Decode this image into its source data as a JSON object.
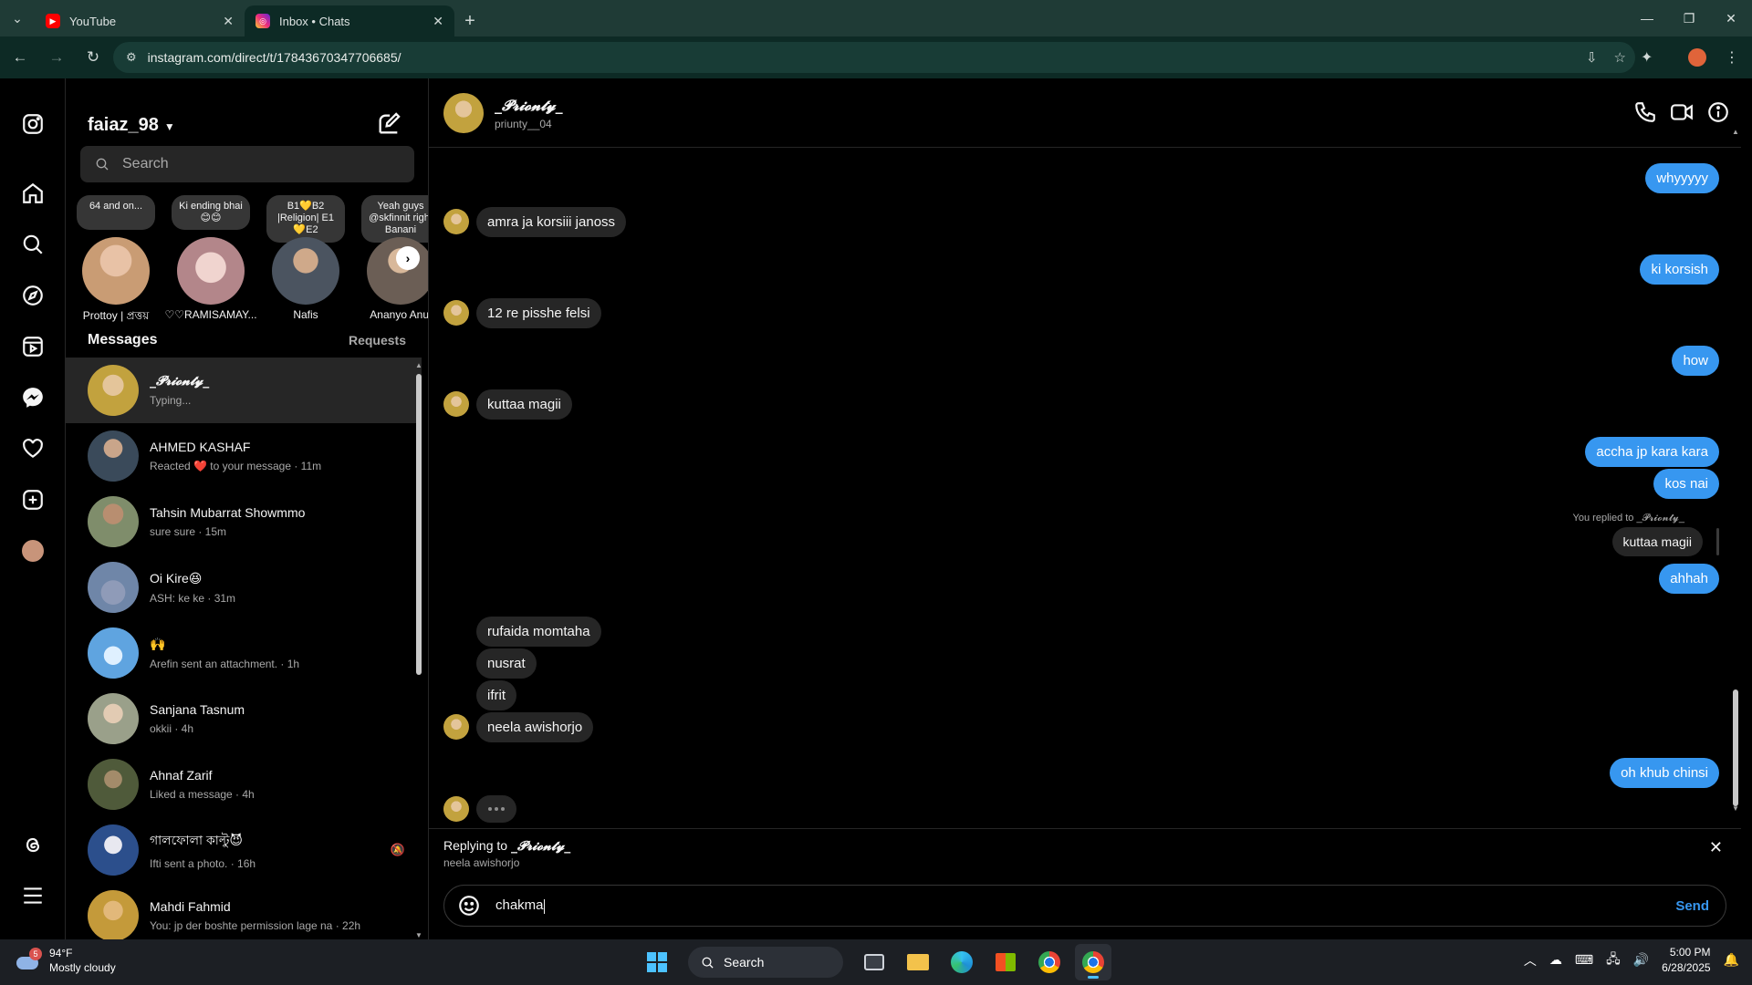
{
  "browser": {
    "tabs": [
      {
        "title": "YouTube",
        "active": false
      },
      {
        "title": "Inbox • Chats",
        "active": true
      }
    ],
    "url": "instagram.com/direct/t/17843670347706685/"
  },
  "sidebar": {
    "username": "faiaz_98",
    "search_placeholder": "Search",
    "notes": [
      {
        "text": "64 and on...",
        "name": "Prottoy | প্রত্তয়",
        "color": "#c99c74"
      },
      {
        "text": "Ki ending bhai 😊😊",
        "name": "♡♡RAMISAMAY...",
        "color": "#b3868a"
      },
      {
        "text": "B1💛B2 |Religion| E1💛E2",
        "name": "Nafis",
        "color": "#4b5460"
      },
      {
        "text": "Yeah guys @skfinnit right Banani",
        "name": "Ananyo Anul",
        "color": "#6b5e55"
      }
    ],
    "messages_label": "Messages",
    "requests_label": "Requests",
    "threads": [
      {
        "name": "_𝓟𝓻𝓲𝓸𝓷𝓽𝔂_",
        "preview": "Typing...",
        "selected": true,
        "color": "#c2a23e"
      },
      {
        "name": "AHMED KASHAF",
        "preview": "Reacted ❤️ to your message · 11m",
        "color": "#3a4a5a"
      },
      {
        "name": "Tahsin Mubarrat Showmmo",
        "preview": "sure sure · 15m",
        "color": "#7f8d6b"
      },
      {
        "name": "Oi Kire😆",
        "preview": "ASH: ke ke · 31m",
        "color": "#6f86a8"
      },
      {
        "name": "🙌",
        "preview": "Arefin sent an attachment. · 1h",
        "color": "#5fa4e0"
      },
      {
        "name": "Sanjana Tasnum",
        "preview": "okkii · 4h",
        "color": "#9aa08a"
      },
      {
        "name": "Ahnaf Zarif",
        "preview": "Liked a message · 4h",
        "color": "#4f5a3a"
      },
      {
        "name": "গালফোলা কাল্টু😈",
        "preview": "Ifti sent a photo. · 16h",
        "muted": true,
        "color": "#2c4f8c"
      },
      {
        "name": "Mahdi Fahmid",
        "preview": "You: jp der boshte permission lage na · 22h",
        "color": "#c49a3a"
      }
    ]
  },
  "chat": {
    "name": "_𝓟𝓻𝓲𝓸𝓷𝓽𝔂_",
    "username": "priunty__04",
    "messages": [
      {
        "dir": "out",
        "text": "whyyyyy"
      },
      {
        "dir": "in",
        "text": "amra ja korsiii janoss"
      },
      {
        "dir": "out",
        "text": "ki korsish"
      },
      {
        "dir": "in",
        "text": "12 re pisshe felsi"
      },
      {
        "dir": "out",
        "text": "how"
      },
      {
        "dir": "in",
        "text": "kuttaa magii"
      },
      {
        "dir": "out",
        "text": "accha jp kara kara"
      },
      {
        "dir": "out",
        "text": "kos nai"
      },
      {
        "dir": "out",
        "text": "ahhah"
      },
      {
        "dir": "in",
        "text": "rufaida momtaha"
      },
      {
        "dir": "in",
        "text": "nusrat"
      },
      {
        "dir": "in",
        "text": "ifrit"
      },
      {
        "dir": "in",
        "text": "neela awishorjo"
      },
      {
        "dir": "out",
        "text": "oh khub chinsi"
      }
    ],
    "reply_note": "You replied to _𝓟𝓻𝓲𝓸𝓷𝓽𝔂_",
    "reply_quote": "kuttaa magii",
    "replying_prefix": "Replying to ",
    "replying_name": "_𝓟𝓻𝓲𝓸𝓷𝓽𝔂_",
    "replying_snippet": "neela awishorjo",
    "composer_value": "chakma",
    "send_label": "Send"
  },
  "taskbar": {
    "weather_temp": "94°F",
    "weather_desc": "Mostly cloudy",
    "weather_badge": "5",
    "search_label": "Search",
    "time": "5:00 PM",
    "date": "6/28/2025"
  }
}
